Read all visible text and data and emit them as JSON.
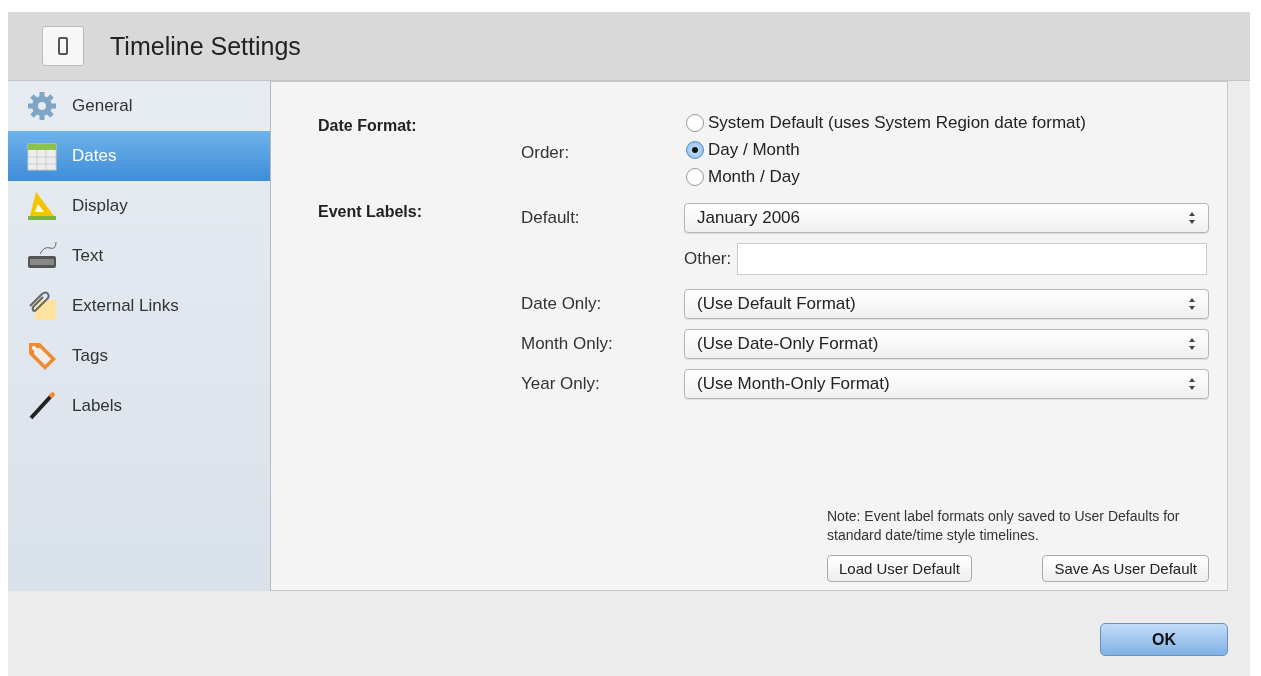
{
  "window": {
    "title": "Timeline Settings"
  },
  "sidebar": {
    "items": [
      {
        "label": "General",
        "kind": "gear",
        "selected": false
      },
      {
        "label": "Dates",
        "kind": "calendar",
        "selected": true
      },
      {
        "label": "Display",
        "kind": "ruler",
        "selected": false
      },
      {
        "label": "Text",
        "kind": "keyboard",
        "selected": false
      },
      {
        "label": "External Links",
        "kind": "paperclip",
        "selected": false
      },
      {
        "label": "Tags",
        "kind": "tag",
        "selected": false
      },
      {
        "label": "Labels",
        "kind": "pencil",
        "selected": false
      }
    ]
  },
  "date_format": {
    "heading": "Date Format:",
    "order_label": "Order:",
    "options": [
      {
        "label": "System Default (uses System Region date format)",
        "selected": false
      },
      {
        "label": "Day / Month",
        "selected": true
      },
      {
        "label": "Month / Day",
        "selected": false
      }
    ]
  },
  "event_labels": {
    "heading": "Event Labels:",
    "rows": [
      {
        "kind": "select",
        "label": "Default:",
        "value": "January 2006"
      },
      {
        "kind": "text",
        "label": "Other:"
      },
      {
        "kind": "select",
        "label": "Date Only:",
        "value": "(Use Default Format)"
      },
      {
        "kind": "select",
        "label": "Month Only:",
        "value": "(Use Date-Only Format)"
      },
      {
        "kind": "select",
        "label": "Year Only:",
        "value": "(Use Month-Only Format)"
      }
    ]
  },
  "note": "Note: Event label formats only saved to User Defaults for standard date/time style timelines.",
  "buttons": [
    "Load User Default",
    "Save As User Default"
  ],
  "ok_button": "OK"
}
